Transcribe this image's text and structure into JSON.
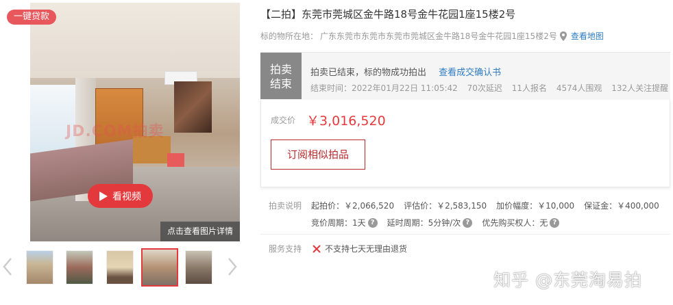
{
  "gallery": {
    "badge": "一键贷款",
    "video_label": "看视频",
    "detail_label": "点击查看图片详情",
    "photo_watermark": "JD.COM拍卖"
  },
  "listing": {
    "title": "【二拍】东莞市莞城区金牛路18号金牛花园1座15楼2号",
    "address_label": "标的物所在地：",
    "address": "广东东莞市东莞市东莞市莞城区金牛路18号金牛花园1座15楼2号",
    "map_link": "查看地图"
  },
  "status": {
    "tag_line1": "拍卖",
    "tag_line2": "结束",
    "message": "拍卖已结束，标的物成功拍出",
    "confirm_link": "查看成交确认书",
    "end_time_label": "结束时间：",
    "end_time": "2022年01月22日 11:05:42",
    "delays": "70次延迟",
    "signups": "11人报名",
    "viewers": "4574人围观",
    "reminders": "132人关注提醒"
  },
  "price": {
    "label": "成交价",
    "value": "￥3,016,520",
    "subscribe": "订阅相似拍品"
  },
  "auction_info": {
    "label": "拍卖说明",
    "start_price": "起拍价：￥2,066,520",
    "appraisal": "评估价：￥2,583,150",
    "increment": "加价幅度：￥10,000",
    "deposit": "保证金：￥400,000",
    "bid_period": "竞价周期：1天",
    "delay_period": "延时周期：5分钟/次",
    "priority": "优先购买权人：无"
  },
  "service": {
    "label": "服务支持",
    "item": "不支持七天无理由退货"
  },
  "footer_watermark": "知乎 @东莞淘易拍",
  "colors": {
    "accent": "#e4393c",
    "link": "#2e7cc4",
    "status_gray": "#888888"
  }
}
